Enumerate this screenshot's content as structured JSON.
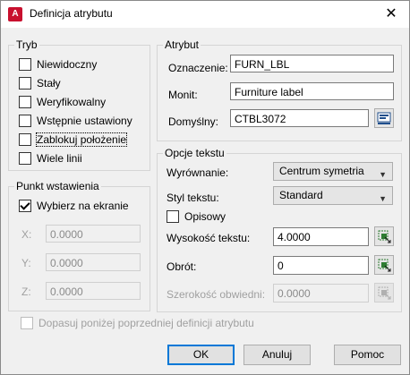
{
  "window": {
    "title": "Definicja atrybutu",
    "icon": "autocad-a-icon",
    "close_glyph": "✕"
  },
  "tryb": {
    "title": "Tryb",
    "items": [
      {
        "label": "Niewidoczny",
        "checked": false
      },
      {
        "label": "Stały",
        "checked": false
      },
      {
        "label": "Weryfikowalny",
        "checked": false
      },
      {
        "label": "Wstępnie ustawiony",
        "checked": false
      },
      {
        "label": "Zablokuj położenie",
        "checked": false
      },
      {
        "label": "Wiele linii",
        "checked": false
      }
    ]
  },
  "punkt": {
    "title": "Punkt wstawienia",
    "on_screen_label": "Wybierz na ekranie",
    "on_screen_checked": true,
    "x_label": "X:",
    "x_value": "0.0000",
    "y_label": "Y:",
    "y_value": "0.0000",
    "z_label": "Z:",
    "z_value": "0.0000"
  },
  "atrybut": {
    "title": "Atrybut",
    "oznaczenie_label": "Oznaczenie:",
    "oznaczenie_value": "FURN_LBL",
    "monit_label": "Monit:",
    "monit_value": "Furniture label",
    "domyslny_label": "Domyślny:",
    "domyslny_value": "CTBL3072"
  },
  "opcje": {
    "title": "Opcje tekstu",
    "wyrownanie_label": "Wyrównanie:",
    "wyrownanie_value": "Centrum symetria",
    "styl_label": "Styl tekstu:",
    "styl_value": "Standard",
    "opisowy_label": "Opisowy",
    "opisowy_checked": false,
    "wysokosc_label": "Wysokość tekstu:",
    "wysokosc_value": "4.0000",
    "obrot_label": "Obrót:",
    "obrot_value": "0",
    "szerokosc_label": "Szerokość obwiedni:",
    "szerokosc_value": "0.0000"
  },
  "footer": {
    "dopasuj_label": "Dopasuj poniżej poprzedniej definicji atrybutu",
    "ok": "OK",
    "cancel": "Anuluj",
    "help": "Pomoc"
  }
}
